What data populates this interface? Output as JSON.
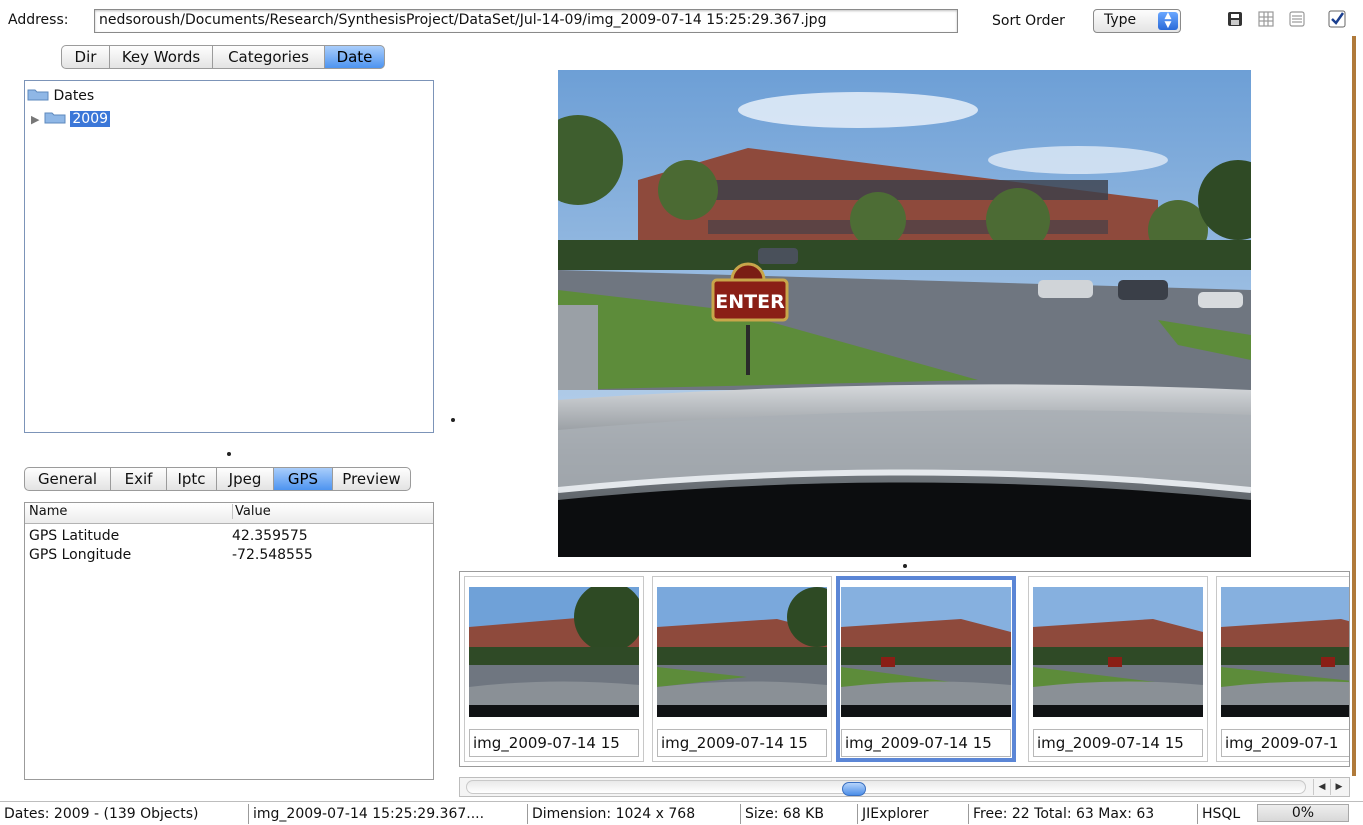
{
  "toolbar": {
    "address_label": "Address:",
    "address_value": "nedsoroush/Documents/Research/SynthesisProject/DataSet/Jul-14-09/img_2009-07-14 15:25:29.367.jpg",
    "sort_label": "Sort Order",
    "sort_value": "Type"
  },
  "nav_tabs": [
    {
      "label": "Dir"
    },
    {
      "label": "Key Words"
    },
    {
      "label": "Categories"
    },
    {
      "label": "Date",
      "active": true
    }
  ],
  "tree": {
    "root_label": "Dates",
    "child_label": "2009"
  },
  "prop_tabs": [
    {
      "label": "General"
    },
    {
      "label": "Exif"
    },
    {
      "label": "Iptc"
    },
    {
      "label": "Jpeg"
    },
    {
      "label": "GPS",
      "active": true
    },
    {
      "label": "Preview"
    }
  ],
  "properties": {
    "header_name": "Name",
    "header_value": "Value",
    "rows": [
      {
        "name": "GPS Latitude",
        "value": "42.359575"
      },
      {
        "name": "GPS Longitude",
        "value": "-72.548555"
      }
    ]
  },
  "main_image": {
    "sign_text": "ENTER"
  },
  "thumbnails": [
    {
      "label": "img_2009-07-14 15"
    },
    {
      "label": "img_2009-07-14 15"
    },
    {
      "label": "img_2009-07-14 15",
      "selected": true
    },
    {
      "label": "img_2009-07-14 15"
    },
    {
      "label": "img_2009-07-1"
    }
  ],
  "status": {
    "dates": "Dates: 2009 - (139 Objects)",
    "file": "img_2009-07-14 15:25:29.367....",
    "dimension": "Dimension: 1024 x 768",
    "size": "Size: 68 KB",
    "app": "JIExplorer",
    "memory": "Free: 22 Total: 63 Max: 63",
    "db": "HSQL",
    "progress": "0%"
  },
  "colors": {
    "tab_active": "#4e94f0",
    "selection": "#3b77d8",
    "thumb_selected_border": "#5b86d6"
  }
}
